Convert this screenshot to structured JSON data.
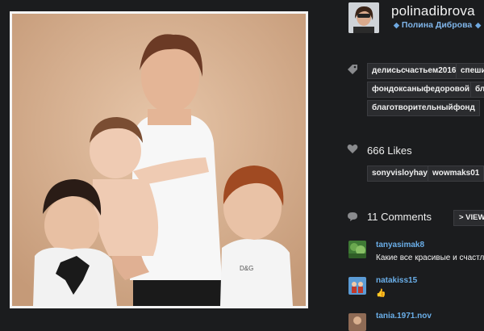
{
  "author": {
    "username": "polinadibrova",
    "full_name": "Полина Диброва",
    "badge_icon": "diamond-icon"
  },
  "tags": [
    "делисьсчастьем2016",
    "спеши",
    "фондоксаныфедоровой",
    "благ",
    "благотворительныйфонд"
  ],
  "likes": {
    "count_label": "666 Likes",
    "users": [
      "sonyvisloyhaya",
      "wowmaks01"
    ]
  },
  "comments": {
    "count_label": "11 Comments",
    "view_all_label": "> VIEW A",
    "items": [
      {
        "user": "tanyasimak8",
        "text": "Какие все красивые и счастли"
      },
      {
        "user": "natakiss15",
        "text": "👍"
      },
      {
        "user": "tania.1971.nov",
        "text": ""
      }
    ]
  },
  "colors": {
    "background": "#1b1c1e",
    "username_link": "#6aaee8",
    "tag_background": "#2b2c2f"
  }
}
